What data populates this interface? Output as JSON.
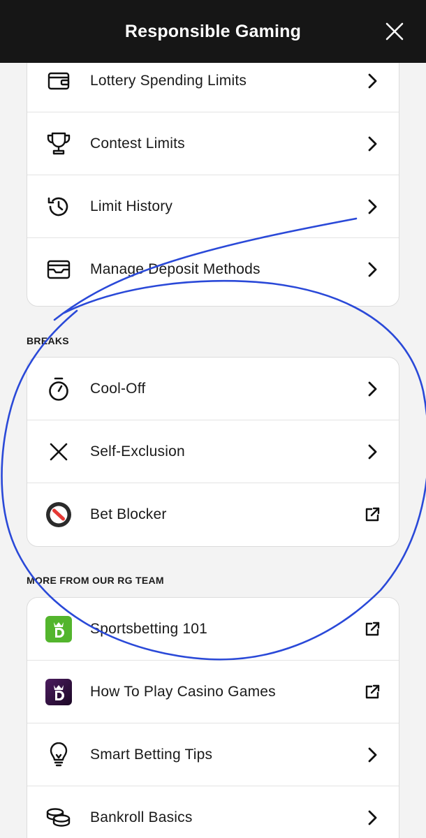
{
  "header": {
    "title": "Responsible Gaming"
  },
  "limits": {
    "items": [
      {
        "label": "Lottery Spending Limits",
        "icon": "wallet-icon",
        "trail": "chevron-right-icon"
      },
      {
        "label": "Contest Limits",
        "icon": "trophy-icon",
        "trail": "chevron-right-icon"
      },
      {
        "label": "Limit History",
        "icon": "history-icon",
        "trail": "chevron-right-icon"
      },
      {
        "label": "Manage Deposit Methods",
        "icon": "card-tray-icon",
        "trail": "chevron-right-icon"
      }
    ]
  },
  "breaks": {
    "title": "BREAKS",
    "items": [
      {
        "label": "Cool-Off",
        "icon": "stopwatch-icon",
        "trail": "chevron-right-icon"
      },
      {
        "label": "Self-Exclusion",
        "icon": "x-icon",
        "trail": "chevron-right-icon"
      },
      {
        "label": "Bet Blocker",
        "icon": "bet-blocker-icon",
        "trail": "external-link-icon"
      }
    ]
  },
  "more": {
    "title": "MORE FROM OUR RG TEAM",
    "items": [
      {
        "label": "Sportsbetting 101",
        "icon": "sportsbook-app-icon",
        "trail": "external-link-icon"
      },
      {
        "label": "How To Play Casino Games",
        "icon": "casino-app-icon",
        "trail": "external-link-icon"
      },
      {
        "label": "Smart Betting Tips",
        "icon": "lightbulb-icon",
        "trail": "chevron-right-icon"
      },
      {
        "label": "Bankroll Basics",
        "icon": "coins-icon",
        "trail": "chevron-right-icon"
      }
    ]
  },
  "colors": {
    "header_bg": "#161616",
    "annotation_ink": "#2a49d8",
    "sportsbook_green": "#53b52d",
    "casino_purple": "#2d0f3b",
    "blocker_red": "#e53935"
  }
}
